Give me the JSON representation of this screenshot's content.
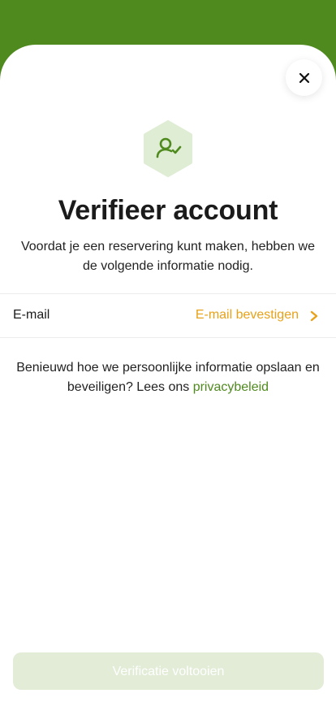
{
  "colors": {
    "brand_green": "#4f8a1e",
    "accent_orange": "#e8a21a",
    "icon_bg": "#dfedd5",
    "button_disabled_bg": "#e2ecd7"
  },
  "header": {
    "close_icon": "close-icon",
    "verify_icon": "user-check-icon"
  },
  "main": {
    "title": "Verifieer account",
    "subtitle": "Voordat je een reservering kunt maken, hebben we de volgende informatie nodig.",
    "email_row": {
      "label": "E-mail",
      "action": "E-mail bevestigen"
    },
    "privacy": {
      "text": "Benieuwd hoe we persoonlijke informatie opslaan en beveiligen? Lees ons ",
      "link": "privacybeleid"
    }
  },
  "footer": {
    "complete_button": "Verificatie voltooien",
    "complete_button_state": "disabled"
  }
}
